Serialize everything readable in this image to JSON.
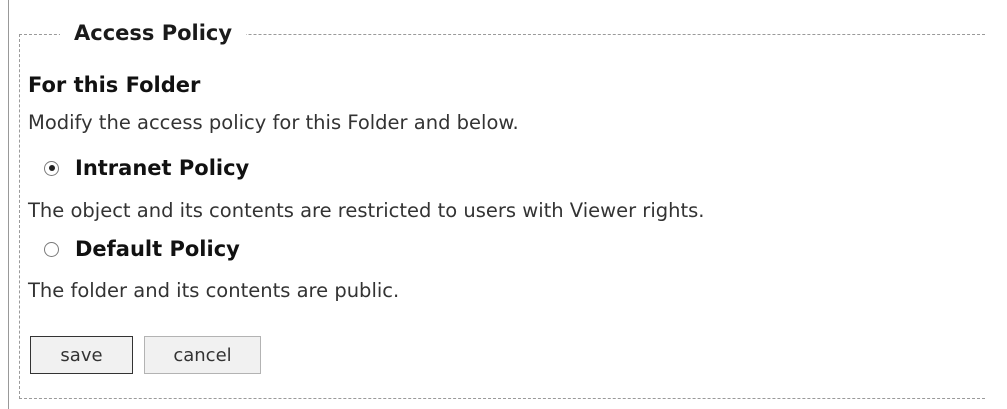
{
  "policy": {
    "legend": "Access Policy",
    "section_heading": "For this Folder",
    "intro": "Modify the access policy for this Folder and below.",
    "options": [
      {
        "label": "Intranet Policy",
        "description": "The object and its contents are restricted to users with Viewer rights.",
        "checked": true
      },
      {
        "label": "Default Policy",
        "description": "The folder and its contents are public.",
        "checked": false
      }
    ]
  },
  "buttons": {
    "save_label": "save",
    "cancel_label": "cancel"
  }
}
